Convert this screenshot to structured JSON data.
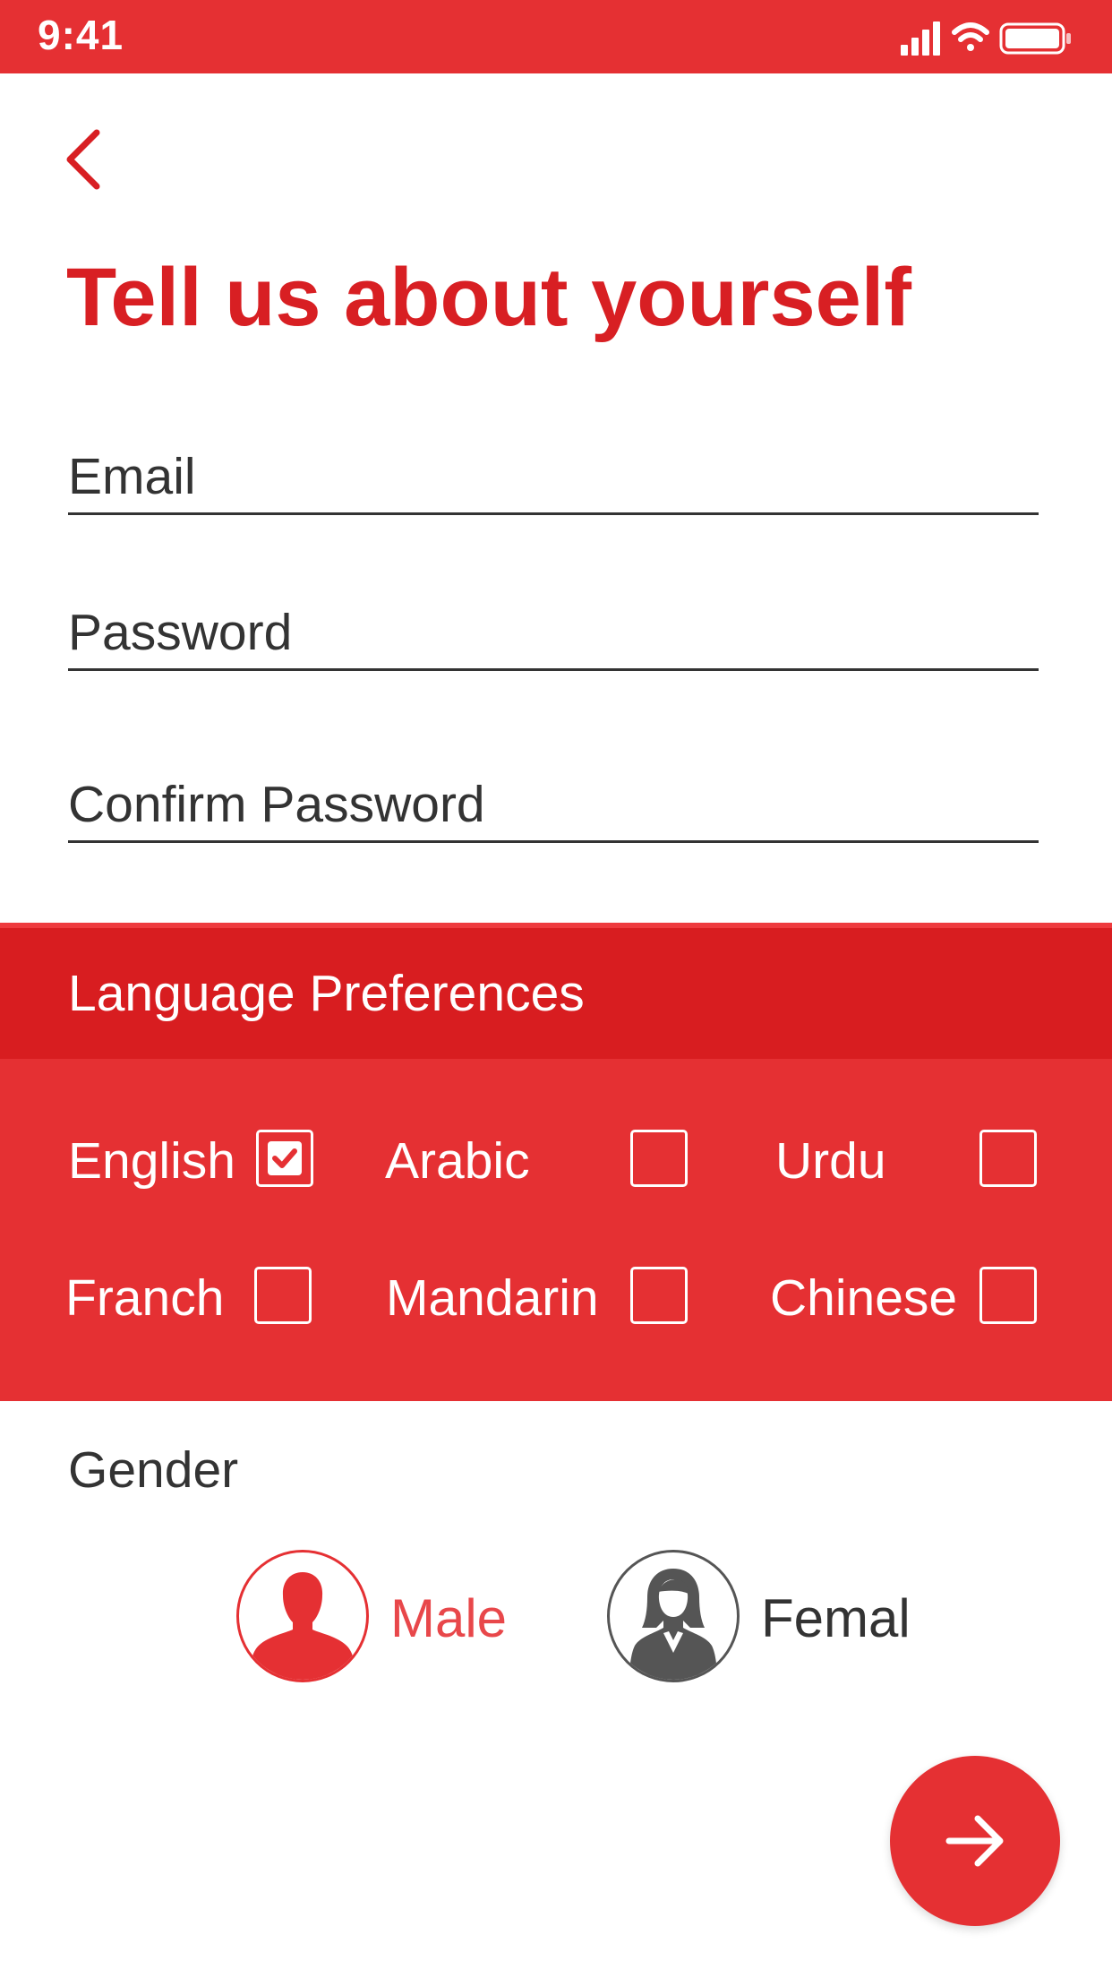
{
  "status_bar": {
    "time": "9:41"
  },
  "header": {
    "title": "Tell us about yourself"
  },
  "form": {
    "email": {
      "placeholder": "Email"
    },
    "password": {
      "placeholder": "Password"
    },
    "confirm_password": {
      "placeholder": "Confirm Password"
    }
  },
  "languages": {
    "heading": "Language Preferences",
    "items": [
      {
        "label": "English",
        "checked": true
      },
      {
        "label": "Arabic",
        "checked": false
      },
      {
        "label": "Urdu",
        "checked": false
      },
      {
        "label": "Franch",
        "checked": false
      },
      {
        "label": "Mandarin",
        "checked": false
      },
      {
        "label": "Chinese",
        "checked": false
      }
    ]
  },
  "gender": {
    "label": "Gender",
    "options": [
      {
        "label": "Male",
        "selected": true
      },
      {
        "label": "Femal",
        "selected": false
      }
    ]
  },
  "colors": {
    "brand_red": "#e53033",
    "title_red": "#d81f23",
    "header_red": "#d81d20",
    "male_text": "#e8474a",
    "female_text": "#333333",
    "avatar_gray": "#555555"
  },
  "icons": {
    "back": "chevron-left-icon",
    "next": "arrow-right-icon",
    "male": "male-avatar-icon",
    "female": "female-avatar-icon",
    "checked": "checkmark-icon"
  }
}
